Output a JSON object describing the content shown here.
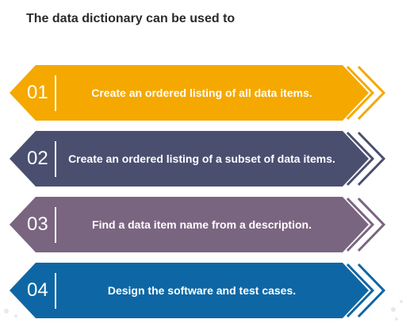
{
  "title": "The data dictionary can be used to",
  "items": [
    {
      "number": "01",
      "text": "Create an ordered listing of all data items.",
      "color": "#F5A800"
    },
    {
      "number": "02",
      "text": "Create an ordered listing of a subset of data items.",
      "color": "#4A4F70"
    },
    {
      "number": "03",
      "text": "Find a data item name from a description.",
      "color": "#7A6580"
    },
    {
      "number": "04",
      "text": "Design the software and test cases.",
      "color": "#0E67A4"
    }
  ]
}
